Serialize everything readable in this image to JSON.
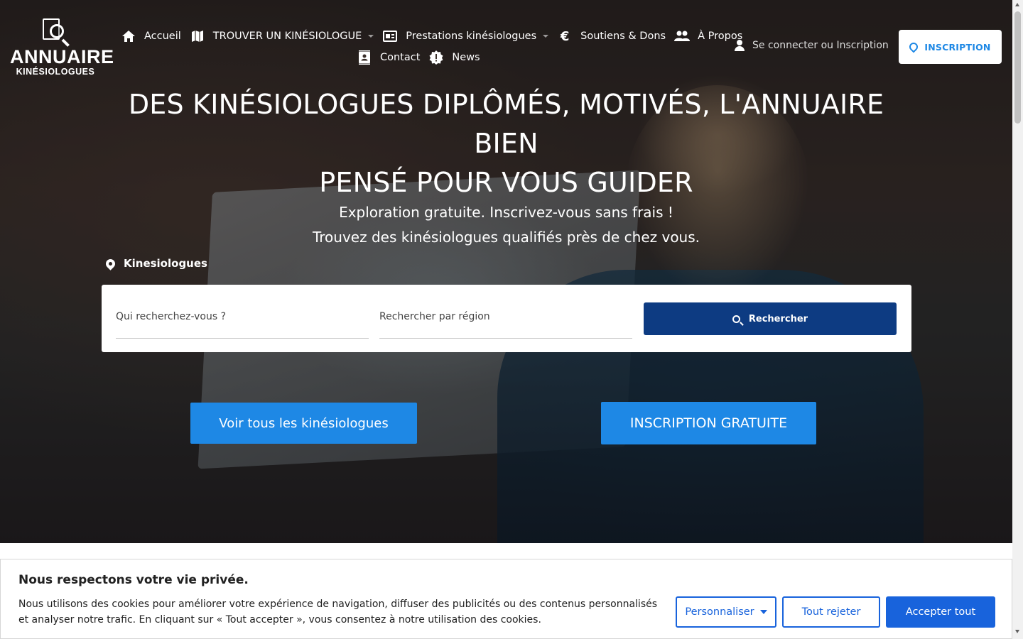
{
  "logo": {
    "title": "ANNUAIRE",
    "subtitle": "KINÉSIOLOGUES"
  },
  "nav": {
    "items": [
      {
        "label": "Accueil",
        "icon": "home-icon"
      },
      {
        "label": "TROUVER UN KINÉSIOLOGUE",
        "icon": "map-icon",
        "dropdown": true
      },
      {
        "label": "Prestations kinésiologues",
        "icon": "newspaper-icon",
        "dropdown": true
      },
      {
        "label": "Soutiens & Dons",
        "icon": "euro-icon"
      },
      {
        "label": "À Propos",
        "icon": "people-icon"
      },
      {
        "label": "Contact",
        "icon": "contact-card-icon"
      },
      {
        "label": "News",
        "icon": "badge-alert-icon"
      }
    ],
    "login_label": "Se connecter ou Inscription",
    "inscription_label": "INSCRIPTION"
  },
  "hero": {
    "headline_line1": "DES KINÉSIOLOGUES DIPLÔMÉS, MOTIVÉS, L'ANNUAIRE BIEN",
    "headline_line2": "PENSÉ POUR VOUS GUIDER",
    "sub_line1": "Exploration gratuite. Inscrivez-vous sans frais !",
    "sub_line2": "Trouvez des kinésiologues qualifiés près de chez vous.",
    "section_label": "Kinesiologues"
  },
  "search": {
    "who_placeholder": "Qui recherchez-vous ?",
    "region_placeholder": "Rechercher par région",
    "button_label": "Rechercher"
  },
  "cta": {
    "see_all": "Voir tous les kinésiologues",
    "signup_free": "INSCRIPTION GRATUITE"
  },
  "cookie": {
    "title": "Nous respectons votre vie privée.",
    "text": "Nous utilisons des cookies pour améliorer votre expérience de navigation, diffuser des publicités ou des contenus personnalisés et analyser notre trafic. En cliquant sur « Tout accepter », vous consentez à notre utilisation des cookies.",
    "customize": "Personnaliser",
    "reject": "Tout rejeter",
    "accept": "Accepter tout"
  },
  "colors": {
    "accent": "#1e88e5",
    "search_button": "#0d3b82",
    "cookie_accent": "#1863dc"
  }
}
